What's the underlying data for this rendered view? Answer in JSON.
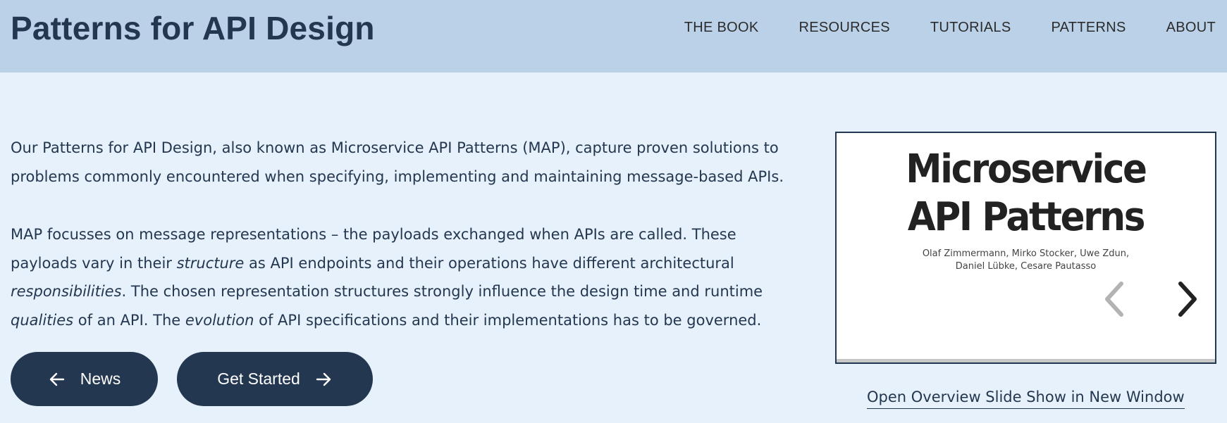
{
  "header": {
    "site_title": "Patterns for API Design",
    "nav": [
      {
        "label": "THE BOOK"
      },
      {
        "label": "RESOURCES"
      },
      {
        "label": "TUTORIALS"
      },
      {
        "label": "PATTERNS"
      },
      {
        "label": "ABOUT"
      }
    ]
  },
  "intro": {
    "paragraph1": "Our Patterns for API Design, also known as Microservice API Patterns (MAP), capture proven solutions to problems commonly encountered when specifying, implementing and maintaining message-based APIs.",
    "paragraph2": {
      "s1": "MAP focusses on message representations – the payloads exchanged when APIs are called. These payloads vary in their ",
      "em1": "structure",
      "s2": " as API endpoints and their operations have different architectural ",
      "em2": "responsibilities",
      "s3": ". The chosen representation structures strongly influence the design time and runtime ",
      "em3": "qualities",
      "s4": " of an API. The ",
      "em4": "evolution",
      "s5": " of API specifications and their implementations has to be governed."
    }
  },
  "buttons": {
    "news_label": "News",
    "news_icon": "arrow-left-icon",
    "get_started_label": "Get Started",
    "get_started_icon": "arrow-right-icon"
  },
  "slideshow": {
    "title_line1": "Microservice",
    "title_line2": "API Patterns",
    "authors_line1": "Olaf Zimmermann, Mirko Stocker, Uwe Zdun,",
    "authors_line2": "Daniel Lübke, Cesare Pautasso",
    "prev_icon": "chevron-left-icon",
    "next_icon": "chevron-right-icon",
    "prev_enabled": false,
    "next_enabled": true,
    "overview_link": "Open Overview Slide Show in New Window"
  },
  "colors": {
    "header_bg": "#bbd1e8",
    "page_bg": "#e6f1fb",
    "primary": "#243750",
    "button_text": "#ffffff",
    "chevron_disabled": "#b3b3b3",
    "chevron_enabled": "#222222"
  }
}
